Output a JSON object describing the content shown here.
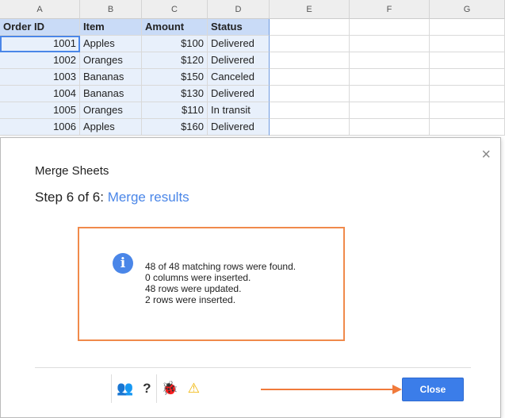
{
  "columns": [
    "A",
    "B",
    "C",
    "D",
    "E",
    "F",
    "G"
  ],
  "table": {
    "headers": [
      "Order ID",
      "Item",
      "Amount",
      "Status"
    ],
    "rows": [
      [
        "1001",
        "Apples",
        "$100",
        "Delivered"
      ],
      [
        "1002",
        "Oranges",
        "$120",
        "Delivered"
      ],
      [
        "1003",
        "Bananas",
        "$150",
        "Canceled"
      ],
      [
        "1004",
        "Bananas",
        "$130",
        "Delivered"
      ],
      [
        "1005",
        "Oranges",
        "$110",
        "In transit"
      ],
      [
        "1006",
        "Apples",
        "$160",
        "Delivered"
      ]
    ]
  },
  "dialog": {
    "title": "Merge Sheets",
    "step_prefix": "Step 6 of 6: ",
    "step_name": "Merge results",
    "close_x": "×",
    "info_icon": "i",
    "messages": [
      "48 of 48 matching rows were found.",
      "0 columns were inserted.",
      "48 rows were updated.",
      "2 rows were inserted."
    ],
    "help": "?",
    "close_button": "Close"
  },
  "colors": {
    "accent": "#4a86e8",
    "highlight": "#f08a4b"
  }
}
